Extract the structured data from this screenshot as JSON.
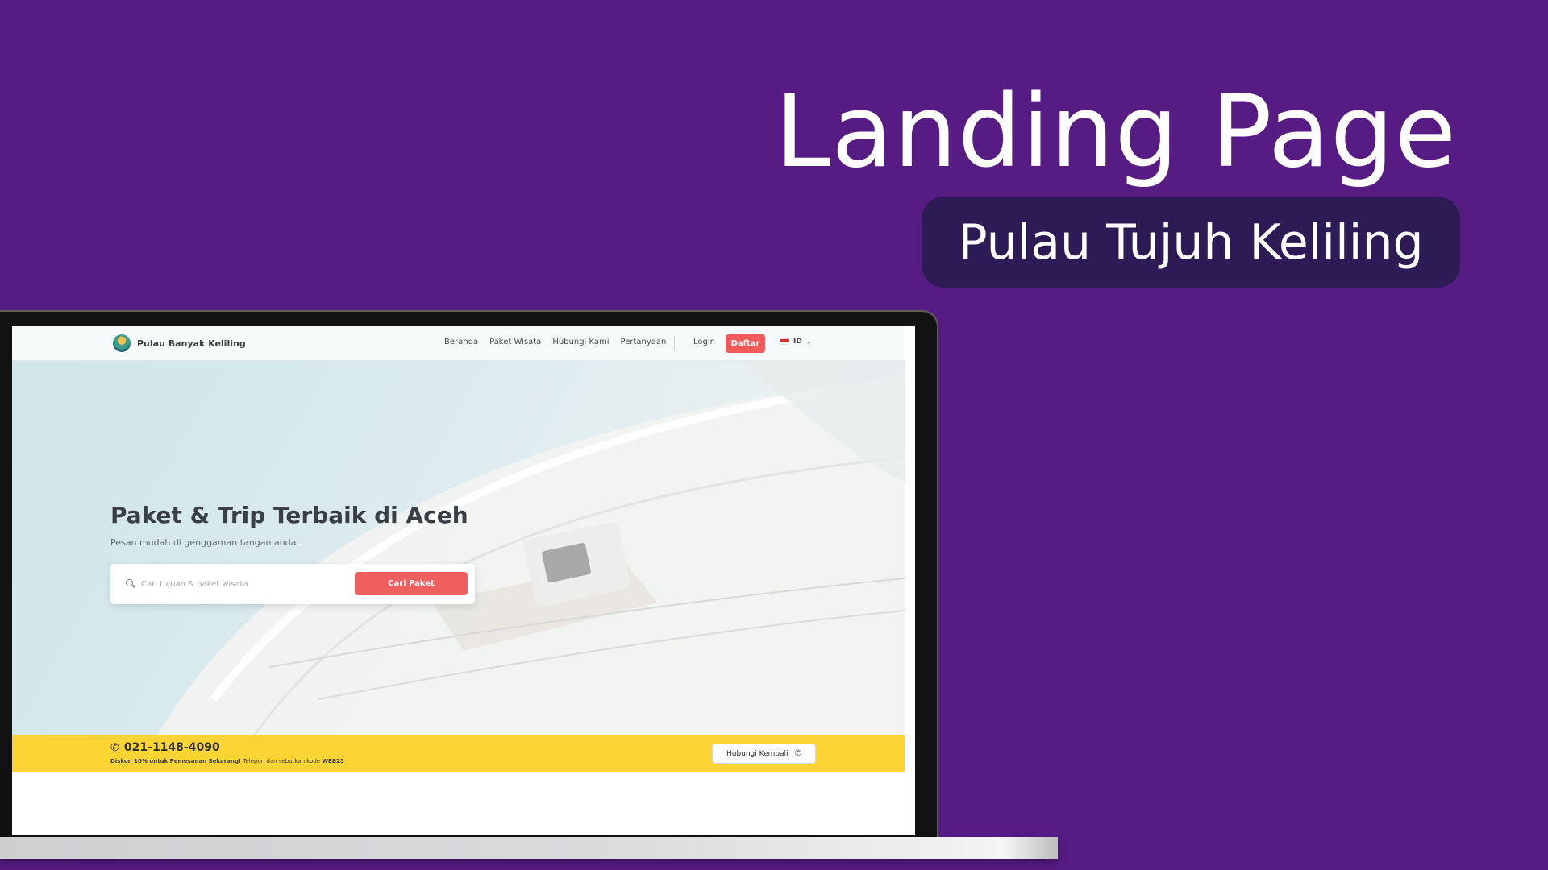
{
  "promo": {
    "title": "Landing Page",
    "subtitle": "Pulau Tujuh Keliling"
  },
  "site": {
    "brand": "Pulau Banyak Keliling",
    "nav": [
      "Beranda",
      "Paket Wisata",
      "Hubungi Kami",
      "Pertanyaan"
    ],
    "login": "Login",
    "register": "Daftar",
    "language": "ID"
  },
  "hero": {
    "title": "Paket & Trip Terbaik di Aceh",
    "subtitle": "Pesan mudah di genggaman tangan anda.",
    "search_placeholder": "Cari tujuan & paket wisata",
    "search_button": "Cari Paket"
  },
  "contact_bar": {
    "phone": "021-1148-4090",
    "note_bold": "Diskon 10% untuk Pemesanan Sekarang!",
    "note_text": " Telepon dan sebutkan kode ",
    "promo_code": "WEB23",
    "callback_button": "Hubungi Kembali"
  },
  "colors": {
    "background": "#561c84",
    "pill": "#2c1b55",
    "accent_red": "#f05a5a",
    "accent_yellow": "#fcd434"
  },
  "icons": [
    "search-icon",
    "phone-icon",
    "flag-icon",
    "chevron-down-icon",
    "logo-icon"
  ]
}
